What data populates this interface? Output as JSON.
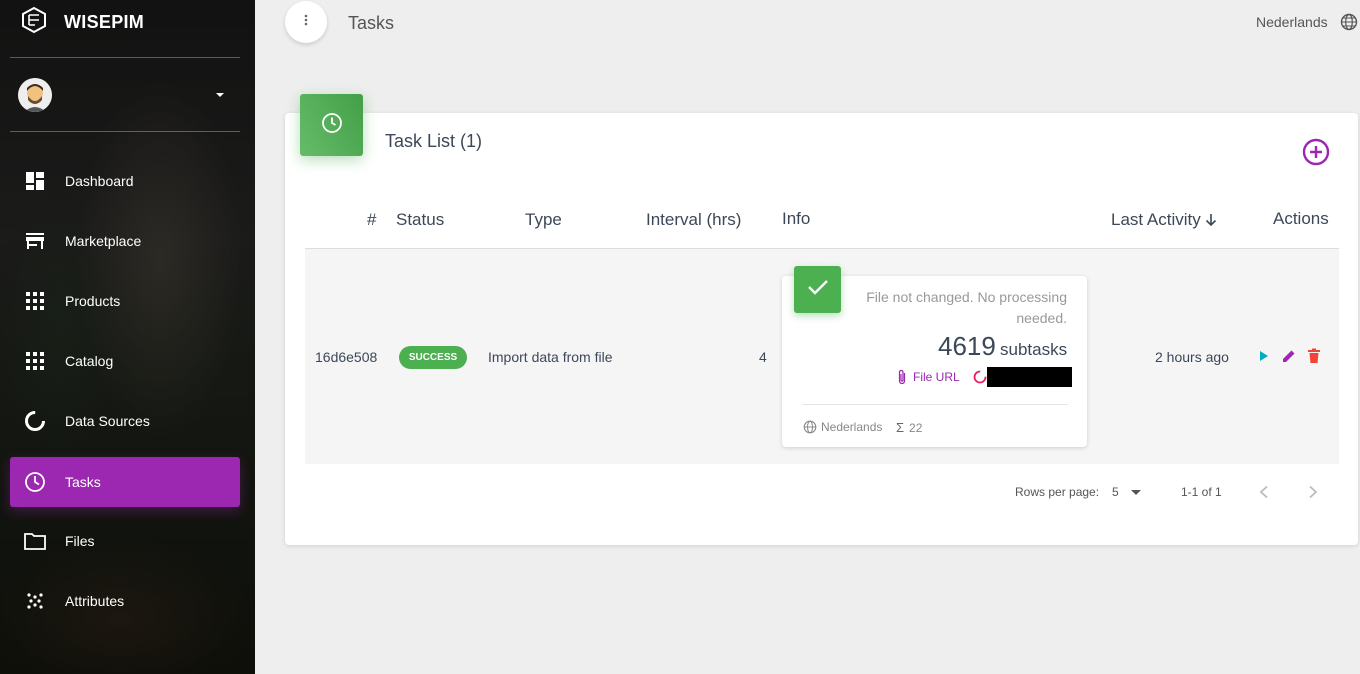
{
  "app": {
    "brand": "WISEPIM"
  },
  "sidebar": {
    "items": [
      {
        "label": "Dashboard",
        "icon": "dashboard-icon"
      },
      {
        "label": "Marketplace",
        "icon": "store-icon"
      },
      {
        "label": "Products",
        "icon": "grid-icon"
      },
      {
        "label": "Catalog",
        "icon": "grid-icon"
      },
      {
        "label": "Data Sources",
        "icon": "donut-icon"
      },
      {
        "label": "Tasks",
        "icon": "clock-icon",
        "active": true
      },
      {
        "label": "Files",
        "icon": "folder-icon"
      },
      {
        "label": "Attributes",
        "icon": "dots-icon"
      }
    ]
  },
  "header": {
    "title": "Tasks",
    "language": "Nederlands"
  },
  "card": {
    "title": "Task List (1)",
    "columns": [
      "#",
      "Status",
      "Type",
      "Interval (hrs)",
      "Info",
      "Last Activity",
      "Actions"
    ],
    "rows": [
      {
        "id": "16d6e508",
        "status": "SUCCESS",
        "type": "Import data from file",
        "interval": "4",
        "info": {
          "message": "File not changed. No processing needed.",
          "count": "4619",
          "count_label": "subtasks",
          "file_url_label": "File URL",
          "language": "Nederlands",
          "sum": "22"
        },
        "last_activity": "2 hours ago"
      }
    ]
  },
  "pagination": {
    "rows_per_page_label": "Rows per page:",
    "rows_per_page": "5",
    "range": "1-1 of 1"
  },
  "colors": {
    "accent": "#9c27b0",
    "success": "#4caf50",
    "play": "#00acc1",
    "delete": "#f44336"
  }
}
